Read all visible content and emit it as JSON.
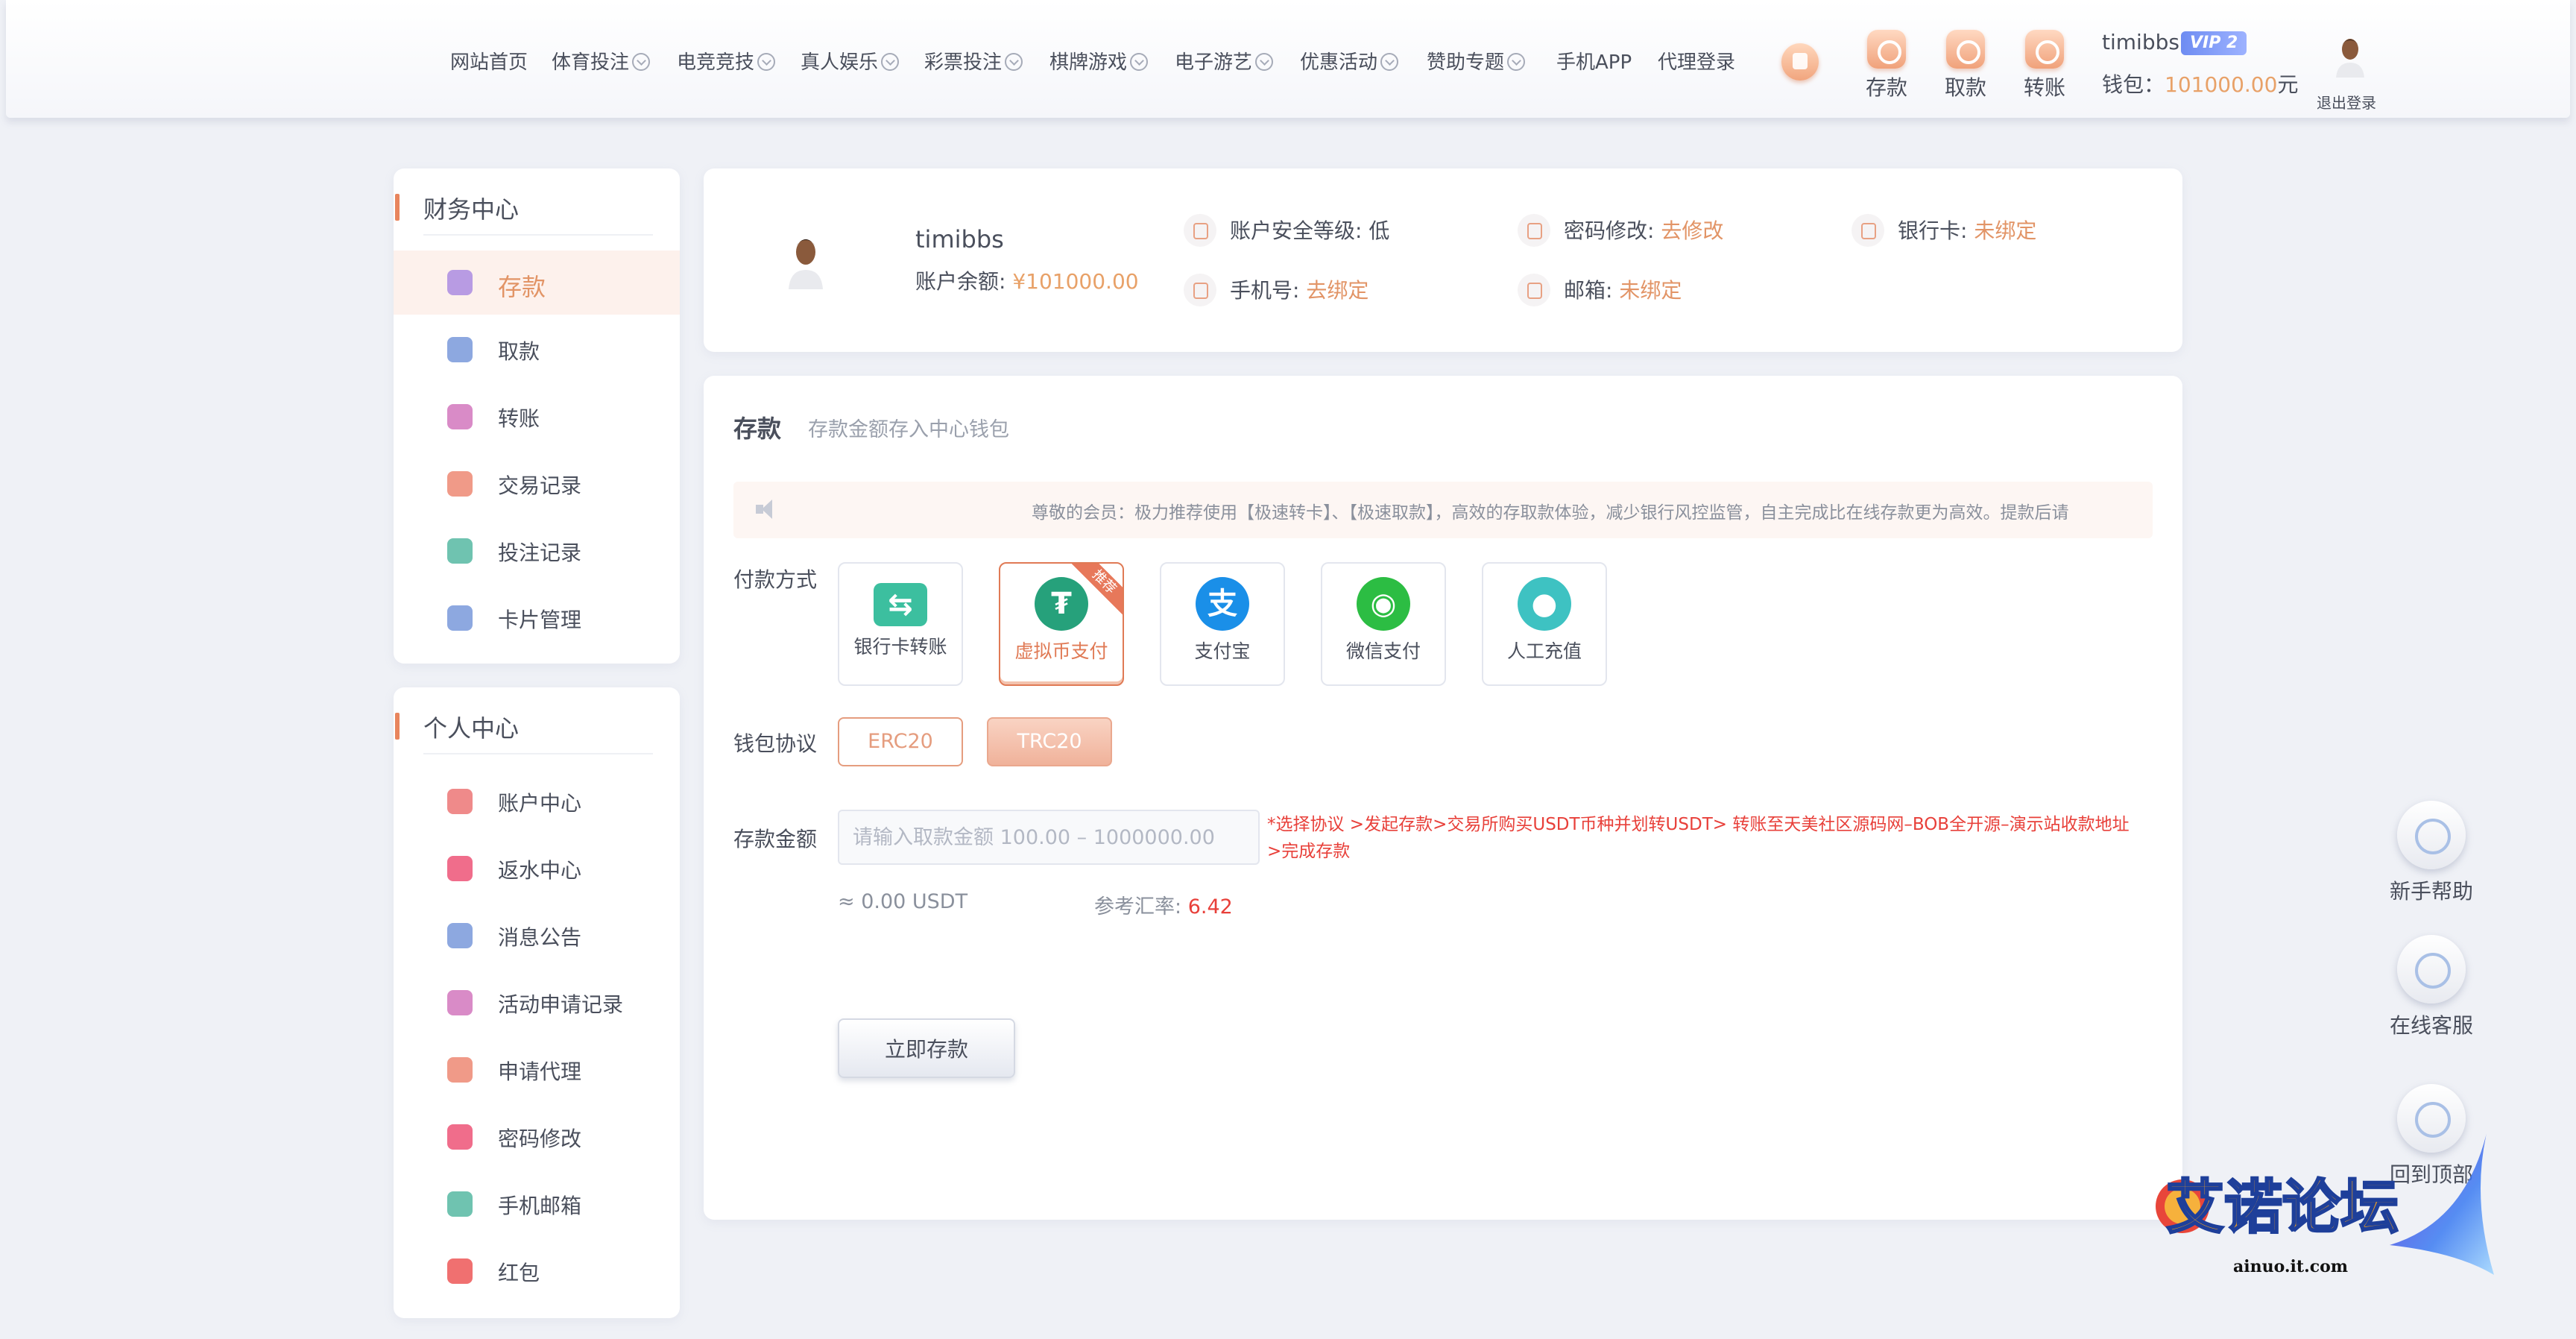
{
  "nav": {
    "items": [
      {
        "label": "网站首页",
        "chevron": false
      },
      {
        "label": "体育投注",
        "chevron": true
      },
      {
        "label": "电竞竞技",
        "chevron": true
      },
      {
        "label": "真人娱乐",
        "chevron": true
      },
      {
        "label": "彩票投注",
        "chevron": true
      },
      {
        "label": "棋牌游戏",
        "chevron": true
      },
      {
        "label": "电子游艺",
        "chevron": true
      },
      {
        "label": "优惠活动",
        "chevron": true
      },
      {
        "label": "赞助专题",
        "chevron": true
      },
      {
        "label": "手机APP",
        "chevron": false
      },
      {
        "label": "代理登录",
        "chevron": false
      }
    ],
    "quick": [
      {
        "label": "存款",
        "icon": "deposit-icon"
      },
      {
        "label": "取款",
        "icon": "withdraw-icon"
      },
      {
        "label": "转账",
        "icon": "transfer-icon"
      }
    ],
    "username": "timibbs",
    "vip": "VIP 2",
    "wallet_label": "钱包：",
    "wallet_amount": "101000.00",
    "wallet_unit": "元",
    "logout": "退出登录"
  },
  "sidebar": {
    "finance_title": "财务中心",
    "finance_items": [
      {
        "label": "存款",
        "icon": "deposit-icon",
        "color": "#b89be3",
        "active": true
      },
      {
        "label": "取款",
        "icon": "wallet-icon",
        "color": "#8da8e0",
        "active": false
      },
      {
        "label": "转账",
        "icon": "transfer-icon",
        "color": "#d98bc7",
        "active": false
      },
      {
        "label": "交易记录",
        "icon": "records-icon",
        "color": "#f09a88",
        "active": false
      },
      {
        "label": "投注记录",
        "icon": "bet-records-icon",
        "color": "#6fc3b0",
        "active": false
      },
      {
        "label": "卡片管理",
        "icon": "card-icon",
        "color": "#8da8e0",
        "active": false
      }
    ],
    "personal_title": "个人中心",
    "personal_items": [
      {
        "label": "账户中心",
        "icon": "heart-icon",
        "color": "#ef8a8a"
      },
      {
        "label": "返水中心",
        "icon": "gift-icon",
        "color": "#f06d8b"
      },
      {
        "label": "消息公告",
        "icon": "bell-icon",
        "color": "#8da8e0"
      },
      {
        "label": "活动申请记录",
        "icon": "apply-record-icon",
        "color": "#d98bc7"
      },
      {
        "label": "申请代理",
        "icon": "agent-icon",
        "color": "#f09a88"
      },
      {
        "label": "密码修改",
        "icon": "lock-icon",
        "color": "#f06d8b"
      },
      {
        "label": "手机邮箱",
        "icon": "mail-icon",
        "color": "#6fc3b0"
      },
      {
        "label": "红包",
        "icon": "red-packet-icon",
        "color": "#f07070"
      }
    ]
  },
  "profile": {
    "name": "timibbs",
    "balance_label": "账户余额:",
    "balance": "¥101000.00",
    "security_label": "账户安全等级:",
    "security_value": "低",
    "password_label": "密码修改:",
    "password_link": "去修改",
    "bank_label": "银行卡:",
    "bank_value": "未绑定",
    "phone_label": "手机号:",
    "phone_link": "去绑定",
    "email_label": "邮箱:",
    "email_value": "未绑定"
  },
  "deposit": {
    "title": "存款",
    "subtitle": "存款金额存入中心钱包",
    "notice": "尊敬的会员：极力推荐使用【极速转卡】、【极速取款】，高效的存取款体验，减少银行风控监管，自主完成比在线存款更为高效。提款后请",
    "method_label": "付款方式",
    "methods": [
      {
        "label": "银行卡转账",
        "icon": "bank-transfer-icon",
        "color": "#3cbf9f",
        "glyph": "⇆",
        "active": false,
        "ribbon": ""
      },
      {
        "label": "虚拟币支付",
        "icon": "usdt-icon",
        "color": "#26a17b",
        "glyph": "₮",
        "active": true,
        "ribbon": "推荐"
      },
      {
        "label": "支付宝",
        "icon": "alipay-icon",
        "color": "#1a8fe8",
        "glyph": "支",
        "active": false,
        "ribbon": ""
      },
      {
        "label": "微信支付",
        "icon": "wechat-icon",
        "color": "#2cbd43",
        "glyph": "◉",
        "active": false,
        "ribbon": ""
      },
      {
        "label": "人工充值",
        "icon": "manual-recharge-icon",
        "color": "#3ec2c2",
        "glyph": "●",
        "active": false,
        "ribbon": ""
      }
    ],
    "protocol_label": "钱包协议",
    "protocols": [
      {
        "label": "ERC20",
        "active": false
      },
      {
        "label": "TRC20",
        "active": true
      }
    ],
    "amount_label": "存款金额",
    "amount_placeholder": "请输入取款金额 100.00 – 1000000.00",
    "hint": "*选择协议 >发起存款>交易所购买USDT币种并划转USDT> 转账至天美社区源码网–BOB全开源–演示站收款地址>完成存款",
    "usdt_value": "≈ 0.00 USDT",
    "rate_label": "参考汇率:",
    "rate_value": "6.42",
    "submit": "立即存款"
  },
  "floating": [
    {
      "label": "新手帮助",
      "icon": "help-robot-icon"
    },
    {
      "label": "在线客服",
      "icon": "headset-icon"
    },
    {
      "label": "回到顶部",
      "icon": "arrow-up-icon"
    }
  ],
  "watermark": {
    "text": "艾诺论坛",
    "url": "ainuo.it.com"
  }
}
